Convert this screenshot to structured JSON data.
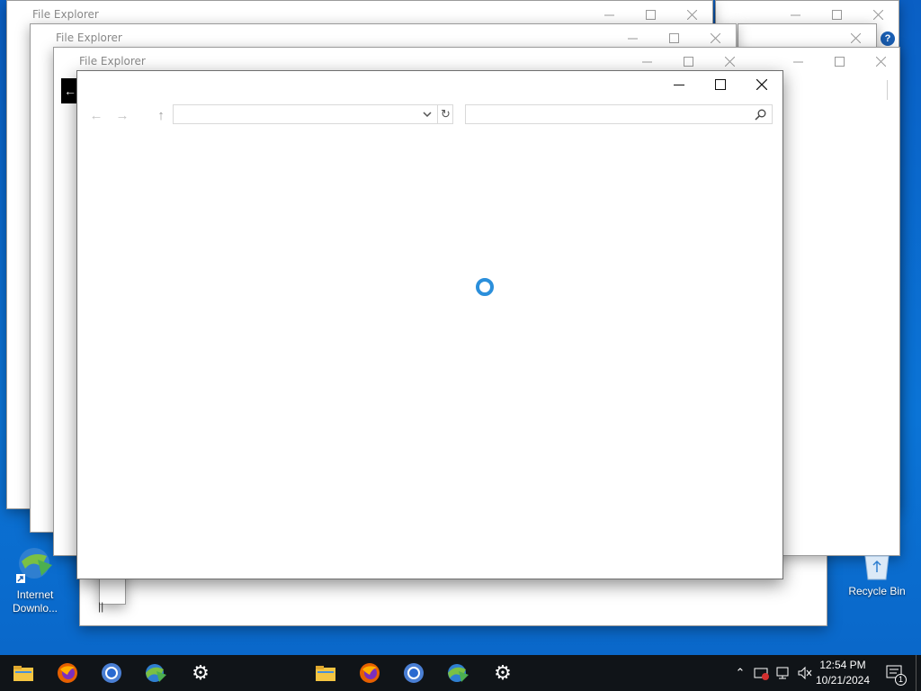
{
  "windows": {
    "explorer_title": "File Explorer"
  },
  "front_dialog": {
    "title": "",
    "address_value": "",
    "search_placeholder": ""
  },
  "desktop": {
    "icons": [
      {
        "label_line1": "Internet",
        "label_line2": "Downlo..."
      },
      {
        "label_line1": "Recycle Bin",
        "label_line2": ""
      }
    ]
  },
  "taskbar": {
    "apps": [
      "file-explorer-icon",
      "firefox-icon",
      "chrome-icon",
      "internet-download-manager-icon",
      "settings-gear-icon"
    ],
    "clock_time": "12:54 PM",
    "clock_date": "10/21/2024",
    "notification_count": "1"
  },
  "colors": {
    "desktop_blue": "#0a66c8",
    "taskbar": "#101418",
    "spinner": "#2b8fdb"
  }
}
